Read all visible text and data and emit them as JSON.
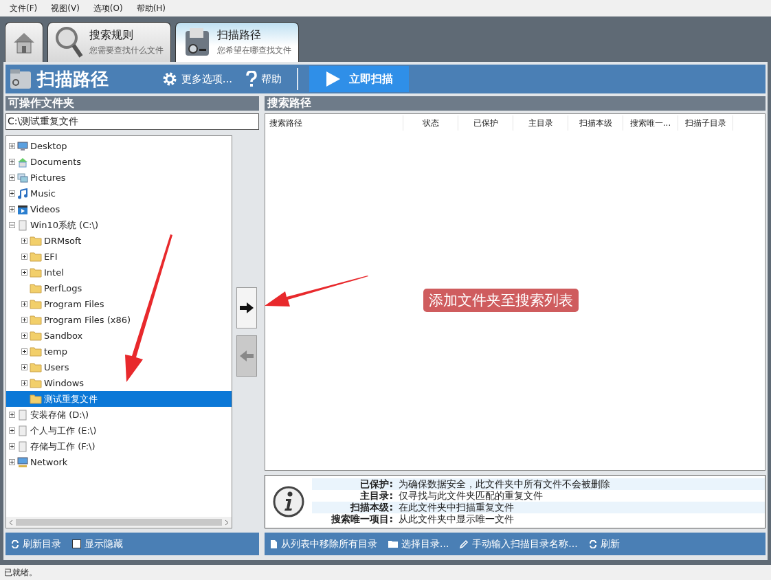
{
  "menu": [
    "文件(F)",
    "视图(V)",
    "选项(O)",
    "帮助(H)"
  ],
  "tabs": [
    {
      "kind": "home",
      "selected": false
    },
    {
      "kind": "search",
      "title": "搜索规则",
      "subtitle": "您需要查找什么文件",
      "selected": false
    },
    {
      "kind": "scan",
      "title": "扫描路径",
      "subtitle": "您希望在哪查找文件",
      "selected": true
    }
  ],
  "header": {
    "title": "扫描路径",
    "actions": [
      {
        "kind": "gear",
        "label": "更多选项..."
      },
      {
        "kind": "help",
        "label": "帮助"
      }
    ],
    "scan_button": "立即扫描"
  },
  "left_panel": {
    "title": "可操作文件夹",
    "path_value": "C:\\测试重复文件",
    "tree": [
      {
        "label": "Desktop",
        "kind": "desktop",
        "expandable": true,
        "selected": false
      },
      {
        "label": "Documents",
        "kind": "home",
        "expandable": true,
        "selected": false
      },
      {
        "label": "Pictures",
        "kind": "pictures",
        "expandable": true,
        "selected": false
      },
      {
        "label": "Music",
        "kind": "music",
        "expandable": true,
        "selected": false
      },
      {
        "label": "Videos",
        "kind": "video",
        "expandable": true,
        "selected": false
      },
      {
        "label": "Win10系统 (C:\\)",
        "kind": "drive",
        "expandable": true,
        "expanded": true,
        "selected": false,
        "children": [
          {
            "label": "DRMsoft",
            "kind": "folder",
            "expandable": true,
            "selected": false
          },
          {
            "label": "EFI",
            "kind": "folder",
            "expandable": true,
            "selected": false
          },
          {
            "label": "Intel",
            "kind": "folder",
            "expandable": true,
            "selected": false
          },
          {
            "label": "PerfLogs",
            "kind": "folder",
            "expandable": false,
            "selected": false
          },
          {
            "label": "Program Files",
            "kind": "folder",
            "expandable": true,
            "selected": false
          },
          {
            "label": "Program Files (x86)",
            "kind": "folder",
            "expandable": true,
            "selected": false
          },
          {
            "label": "Sandbox",
            "kind": "folder",
            "expandable": true,
            "selected": false
          },
          {
            "label": "temp",
            "kind": "folder",
            "expandable": true,
            "selected": false
          },
          {
            "label": "Users",
            "kind": "folder",
            "expandable": true,
            "selected": false
          },
          {
            "label": "Windows",
            "kind": "folder",
            "expandable": true,
            "selected": false
          },
          {
            "label": "测试重复文件",
            "kind": "folder",
            "expandable": false,
            "selected": true
          }
        ]
      },
      {
        "label": "安装存储 (D:\\)",
        "kind": "drive",
        "expandable": true,
        "selected": false
      },
      {
        "label": "个人与工作 (E:\\)",
        "kind": "drive",
        "expandable": true,
        "selected": false
      },
      {
        "label": "存储与工作 (F:\\)",
        "kind": "drive",
        "expandable": true,
        "selected": false
      },
      {
        "label": "Network",
        "kind": "network",
        "expandable": true,
        "selected": false
      }
    ],
    "refresh_button": "刷新目录",
    "show_hidden": {
      "label": "显示隐藏",
      "checked": false
    }
  },
  "transfer_buttons": [
    {
      "kind": "add",
      "disabled": false
    },
    {
      "kind": "remove",
      "disabled": true
    }
  ],
  "right_panel": {
    "title": "搜索路径",
    "columns": [
      "搜索路径",
      "状态",
      "已保护",
      "主目录",
      "扫描本级",
      "搜索唯一...",
      "扫描子目录"
    ],
    "info": [
      {
        "term": "已保护:",
        "text": "为确保数据安全，此文件夹中所有文件不会被删除"
      },
      {
        "term": "主目录:",
        "text": "仅寻找与此文件夹匹配的重复文件"
      },
      {
        "term": "扫描本级:",
        "text": "在此文件夹中扫描重复文件"
      },
      {
        "term": "搜索唯一项目:",
        "text": "从此文件夹中显示唯一文件"
      }
    ],
    "buttons": [
      {
        "kind": "page",
        "label": "从列表中移除所有目录"
      },
      {
        "kind": "folder",
        "label": "选择目录..."
      },
      {
        "kind": "pen",
        "label": "手动输入扫描目录名称..."
      },
      {
        "kind": "refresh",
        "label": "刷新"
      }
    ]
  },
  "callout": "添加文件夹至搜索列表",
  "status_bar": "已就绪。"
}
